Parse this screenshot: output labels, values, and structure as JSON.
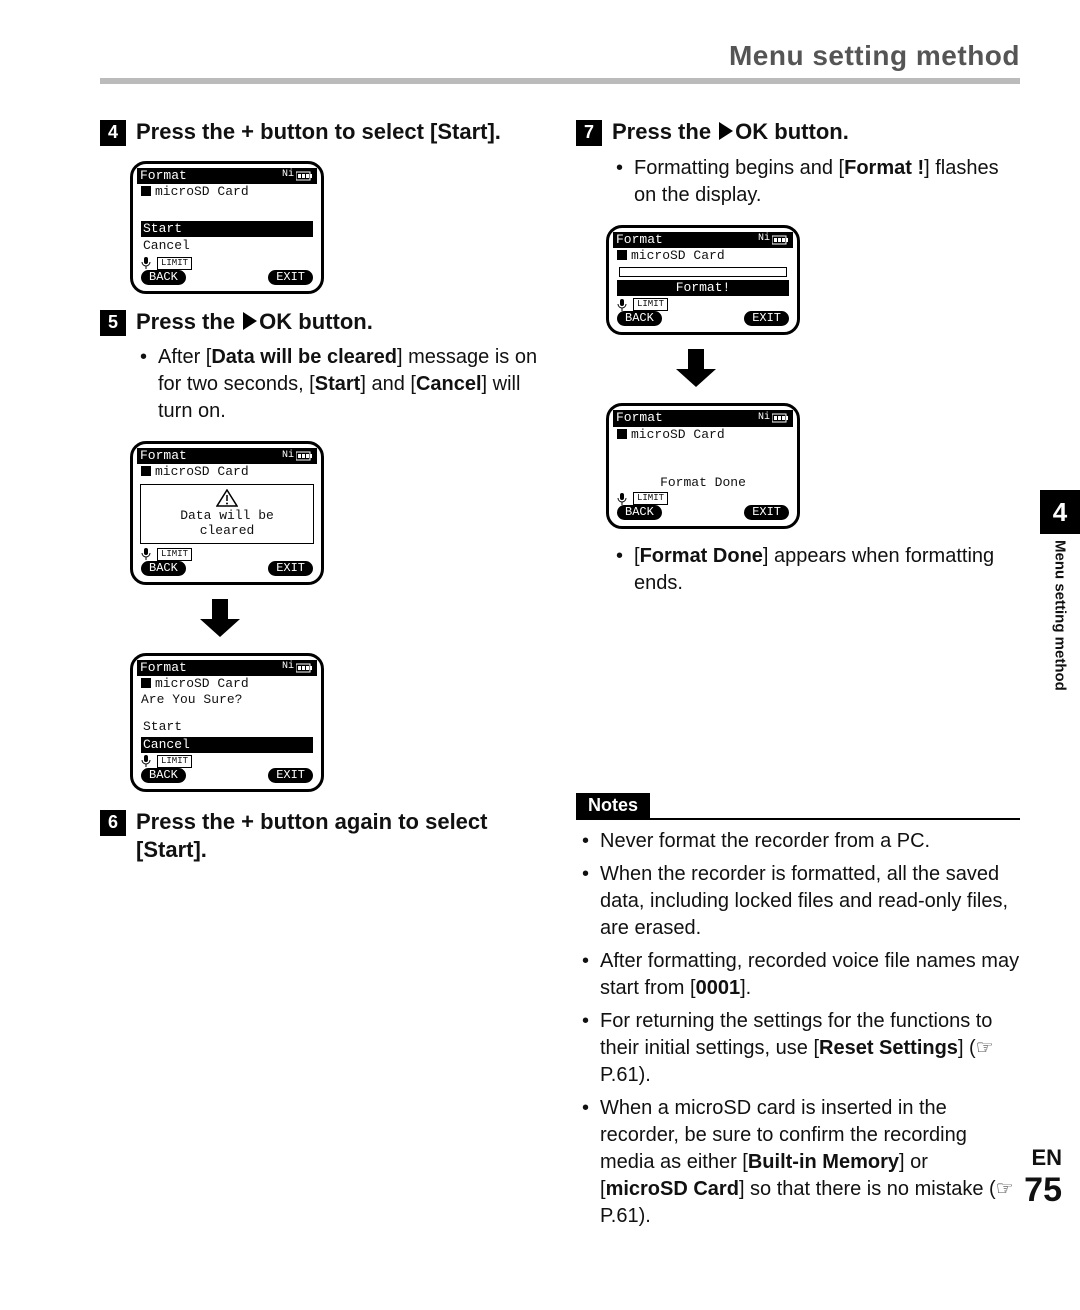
{
  "header": {
    "title": "Menu setting method"
  },
  "sidebar": {
    "chapter": "4",
    "title": "Menu setting method"
  },
  "footer": {
    "lang": "EN",
    "page": "75"
  },
  "lcd_common": {
    "title": "Format",
    "batt_label": "Ni",
    "sd_line": "microSD Card",
    "soft_back": "BACK",
    "soft_exit": "EXIT",
    "limit_tag": "LIMIT"
  },
  "lcd1": {
    "opt_start": "Start",
    "opt_cancel": "Cancel"
  },
  "lcd2": {
    "warn_l1": "Data will be",
    "warn_l2": "cleared"
  },
  "lcd3": {
    "confirm": "Are You Sure?",
    "opt_start": "Start",
    "opt_cancel": "Cancel"
  },
  "lcd4": {
    "progress_label": "Format!"
  },
  "lcd5": {
    "done_label": "Format Done"
  },
  "step4": {
    "num": "4",
    "text_pre": "Press the + button to select [",
    "bold": "Start",
    "text_post": "]."
  },
  "step5": {
    "num": "5",
    "text_pre": "Press the ",
    "text_post": "OK button.",
    "bullet_pre": "After [",
    "bullet_b1": "Data will be cleared",
    "bullet_mid1": "] message is on for two seconds, [",
    "bullet_b2": "Start",
    "bullet_mid2": "] and [",
    "bullet_b3": "Cancel",
    "bullet_post": "] will turn on."
  },
  "step6": {
    "num": "6",
    "text_pre": "Press the + button again to select [",
    "bold": "Start",
    "text_post": "]."
  },
  "step7": {
    "num": "7",
    "text_pre": "Press the ",
    "text_post": "OK button.",
    "bullet1_pre": "Formatting begins and [",
    "bullet1_b": "Format !",
    "bullet1_post": "] flashes on the display.",
    "bullet2_pre": "[",
    "bullet2_b": "Format Done",
    "bullet2_post": "] appears when formatting ends."
  },
  "notes": {
    "label": "Notes",
    "n1": "Never format the recorder from a PC.",
    "n2": "When the recorder is formatted, all the saved data, including locked files and read-only files, are erased.",
    "n3_pre": "After formatting, recorded voice file names may start from [",
    "n3_b": "0001",
    "n3_post": "].",
    "n4_pre": "For returning the settings for the functions to their initial settings, use [",
    "n4_b": "Reset Settings",
    "n4_post": "] (☞ P.61).",
    "n5_pre": "When a microSD card is inserted in the recorder, be sure to confirm the recording media as either [",
    "n5_b1": "Built-in Memory",
    "n5_mid": "] or [",
    "n5_b2": "microSD Card",
    "n5_post": "] so that there is no mistake (☞ P.61)."
  }
}
